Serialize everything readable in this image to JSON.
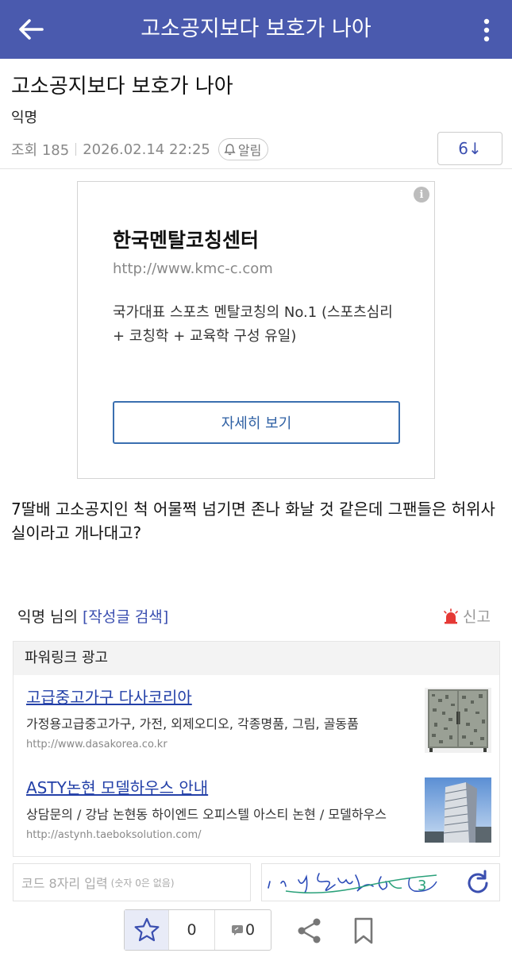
{
  "topbar": {
    "title": "고소공지보다 보호가 나아",
    "back_icon": "arrow-left-icon",
    "more_icon": "more-vertical-icon"
  },
  "post": {
    "title": "고소공지보다 보호가 나아",
    "author": "익명",
    "views_label": "조회 185",
    "datetime": "2026.02.14 22:25",
    "alarm_label": "알림",
    "comment_count_label": "6↓",
    "body": "7딸배 고소공지인 척 어물쩍 넘기면 존나 화날 것 같은데 그팬들은 허위사실이라고 개나대고?"
  },
  "ad": {
    "name": "한국멘탈코칭센터",
    "url": "http://www.kmc-c.com",
    "description": "국가대표 스포츠 멘탈코칭의 No.1 (스포츠심리 + 코칭학 + 교육학 구성 유일)",
    "cta": "자세히 보기",
    "info_icon": "info-icon"
  },
  "author_line": {
    "text": "익명 님의",
    "search_link": "[작성글 검색]",
    "report_label": "신고"
  },
  "powerlink": {
    "header": "파워링크 광고",
    "items": [
      {
        "title": "고급중고가구 다사코리아",
        "desc": "가정용고급중고가구, 가전, 외제오디오, 각종명품, 그림, 골동품",
        "url": "http://www.dasakorea.co.kr"
      },
      {
        "title": "ASTY논현 모델하우스 안내",
        "desc": "상담문의 / 강남 논현동 하이엔드 오피스텔 아스티 논현 / 모델하우스",
        "url": "http://astynh.taeboksolution.com/"
      }
    ]
  },
  "captcha": {
    "placeholder": "코드 8자리 입력",
    "placeholder_note": "(숫자 0은 없음)",
    "refresh_icon": "refresh-icon"
  },
  "bottombar": {
    "like_count": "0",
    "comment_count": "0",
    "share_icon": "share-icon",
    "bookmark_icon": "bookmark-icon"
  },
  "colors": {
    "header_bg": "#4a5aae",
    "link": "#2340a8",
    "accent": "#3b4fb0",
    "report_red": "#e53935"
  }
}
